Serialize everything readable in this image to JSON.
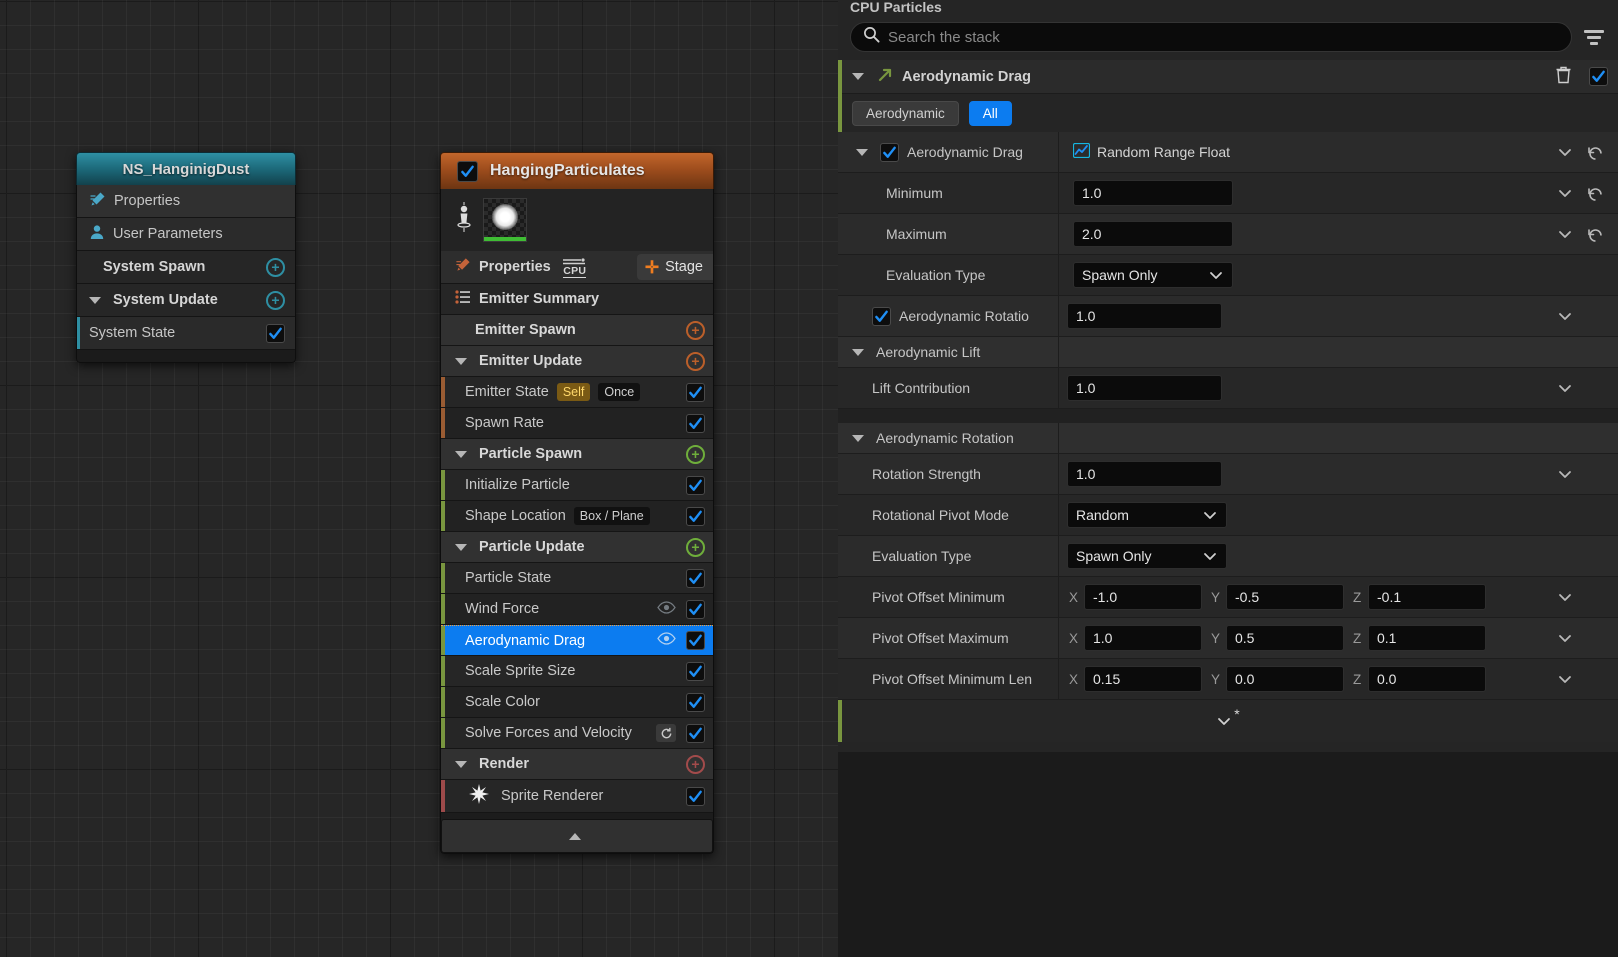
{
  "graph": {
    "system_node": {
      "title": "NS_HanginigDust",
      "rows": [
        {
          "label": "Properties",
          "icon": "pencil-icon",
          "type": "item"
        },
        {
          "label": "User Parameters",
          "icon": "user-icon",
          "type": "item"
        },
        {
          "label": "System Spawn",
          "type": "group",
          "add": "plus-circle-icon"
        },
        {
          "label": "System Update",
          "type": "group",
          "add": "plus-circle-icon",
          "expanded": true
        },
        {
          "label": "System State",
          "type": "module",
          "checked": true
        }
      ]
    },
    "emitter_node": {
      "title": "HangingParticulates",
      "enabled": true,
      "properties_label": "Properties",
      "sim_target": "CPU",
      "stage_button": "Stage",
      "rows": [
        {
          "label": "Emitter Summary",
          "type": "item",
          "icon": "list-icon"
        },
        {
          "label": "Emitter Spawn",
          "type": "group",
          "add": "plus-circle-icon"
        },
        {
          "label": "Emitter Update",
          "type": "group",
          "add": "plus-circle-icon",
          "expanded": true
        },
        {
          "label": "Emitter State",
          "type": "module",
          "stripe": "orange",
          "tags": [
            "Self",
            "Once"
          ],
          "checked": true
        },
        {
          "label": "Spawn Rate",
          "type": "module",
          "stripe": "orange",
          "checked": true
        },
        {
          "label": "Particle Spawn",
          "type": "group",
          "add": "plus-circle-icon",
          "expanded": true
        },
        {
          "label": "Initialize Particle",
          "type": "module",
          "stripe": "green",
          "checked": true
        },
        {
          "label": "Shape Location",
          "type": "module",
          "stripe": "green",
          "tags": [
            "Box / Plane"
          ],
          "checked": true
        },
        {
          "label": "Particle Update",
          "type": "group",
          "add": "plus-circle-icon",
          "expanded": true
        },
        {
          "label": "Particle State",
          "type": "module",
          "stripe": "green",
          "checked": true
        },
        {
          "label": "Wind Force",
          "type": "module",
          "stripe": "green",
          "eye": true,
          "checked": true
        },
        {
          "label": "Aerodynamic Drag",
          "type": "module",
          "stripe": "green",
          "eye": true,
          "checked": true,
          "selected": true
        },
        {
          "label": "Scale Sprite Size",
          "type": "module",
          "stripe": "green",
          "checked": true
        },
        {
          "label": "Scale Color",
          "type": "module",
          "stripe": "green",
          "checked": true
        },
        {
          "label": "Solve Forces and Velocity",
          "type": "module",
          "stripe": "green",
          "reset": true,
          "checked": true
        },
        {
          "label": "Render",
          "type": "group",
          "add": "plus-circle-icon",
          "expanded": true
        },
        {
          "label": "Sprite Renderer",
          "type": "module",
          "stripe": "red",
          "icon": "star-icon",
          "checked": true
        }
      ]
    }
  },
  "details": {
    "panel_title": "CPU Particles",
    "search": {
      "placeholder": "Search the stack",
      "value": ""
    },
    "module": {
      "name": "Aerodynamic Drag",
      "enabled": true,
      "delete_icon": "trash-icon",
      "filters": [
        {
          "label": "Aerodynamic",
          "active": false
        },
        {
          "label": "All",
          "active": true
        }
      ]
    },
    "rows": [
      {
        "kind": "input_header",
        "name": "Aerodynamic Drag",
        "checkbox": true,
        "type_label": "Random Range Float",
        "type_icon": "curve-icon",
        "has_chevron": true,
        "has_undo": true
      },
      {
        "kind": "value",
        "name": "Minimum",
        "indent": 2,
        "value": "1.0",
        "has_chevron": true,
        "has_undo": true
      },
      {
        "kind": "value",
        "name": "Maximum",
        "indent": 2,
        "value": "2.0",
        "has_chevron": true,
        "has_undo": true
      },
      {
        "kind": "select",
        "name": "Evaluation Type",
        "indent": 2,
        "value": "Spawn Only"
      },
      {
        "kind": "value",
        "name": "Aerodynamic Rotatio",
        "checkbox": true,
        "indent": 1,
        "value": "1.0",
        "has_chevron": true
      },
      {
        "kind": "section",
        "name": "Aerodynamic Lift"
      },
      {
        "kind": "value",
        "name": "Lift Contribution",
        "indent": 1,
        "value": "1.0",
        "has_chevron": true
      },
      {
        "kind": "gap"
      },
      {
        "kind": "section",
        "name": "Aerodynamic Rotation"
      },
      {
        "kind": "value",
        "name": "Rotation Strength",
        "indent": 1,
        "value": "1.0",
        "has_chevron": true
      },
      {
        "kind": "select",
        "name": "Rotational Pivot Mode",
        "indent": 1,
        "value": "Random"
      },
      {
        "kind": "select",
        "name": "Evaluation Type",
        "indent": 1,
        "value": "Spawn Only"
      },
      {
        "kind": "vector",
        "name": "Pivot Offset Minimum",
        "indent": 1,
        "x": "-1.0",
        "y": "-0.5",
        "z": "-0.1",
        "has_chevron": true
      },
      {
        "kind": "vector",
        "name": "Pivot Offset Maximum",
        "indent": 1,
        "x": "1.0",
        "y": "0.5",
        "z": "0.1",
        "has_chevron": true
      },
      {
        "kind": "vector",
        "name": "Pivot Offset Minimum Len",
        "indent": 1,
        "x": "0.15",
        "y": "0.0",
        "z": "0.0",
        "has_chevron": true
      }
    ],
    "axis_labels": {
      "x": "X",
      "y": "Y",
      "z": "Z"
    },
    "more_marker": "*"
  },
  "colors": {
    "accent_blue": "#0c7cf0",
    "emitter_orange": "#c2662b",
    "system_cyan": "#2e8fa3",
    "stack_green": "#79963f",
    "gold_tag": "#ffd86b"
  }
}
